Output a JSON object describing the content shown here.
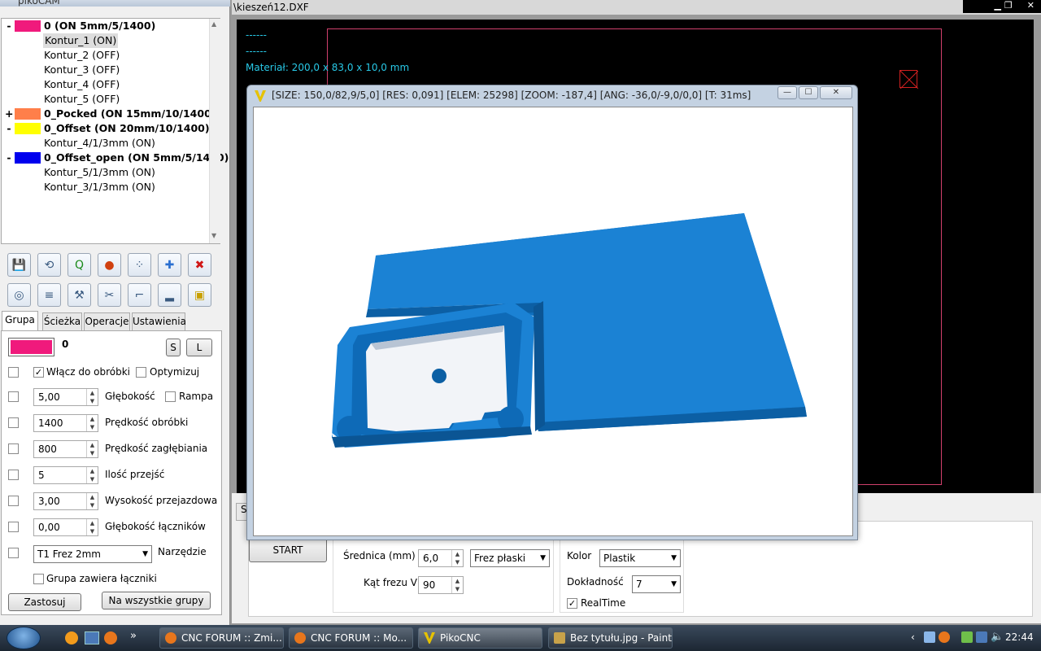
{
  "left_window": {
    "title": "pikoCAM",
    "tree": [
      {
        "expander": "-",
        "color": "#f01a7c",
        "label": "0 (ON 5mm/5/1400)",
        "type": "group"
      },
      {
        "expander": "",
        "color": "",
        "label": "Kontur_1 (ON)",
        "type": "item",
        "selected": true
      },
      {
        "expander": "",
        "color": "",
        "label": "Kontur_2 (OFF)",
        "type": "item"
      },
      {
        "expander": "",
        "color": "",
        "label": "Kontur_3 (OFF)",
        "type": "item"
      },
      {
        "expander": "",
        "color": "",
        "label": "Kontur_4 (OFF)",
        "type": "item"
      },
      {
        "expander": "",
        "color": "",
        "label": "Kontur_5 (OFF)",
        "type": "item"
      },
      {
        "expander": "+",
        "color": "#ff7f4a",
        "label": "0_Pocked (ON 15mm/10/1400)",
        "type": "group"
      },
      {
        "expander": "-",
        "color": "#ffff00",
        "label": "0_Offset (ON 20mm/10/1400)",
        "type": "group"
      },
      {
        "expander": "",
        "color": "",
        "label": "Kontur_4/1/3mm (ON)",
        "type": "item"
      },
      {
        "expander": "-",
        "color": "#0000ee",
        "label": "0_Offset_open (ON 5mm/5/1400)",
        "type": "group"
      },
      {
        "expander": "",
        "color": "",
        "label": "Kontur_5/1/3mm (ON)",
        "type": "item"
      },
      {
        "expander": "",
        "color": "",
        "label": "Kontur_3/1/3mm (ON)",
        "type": "item"
      }
    ],
    "toolbar_icons_row1": [
      "save-icon",
      "refresh-icon",
      "q-icon",
      "record-icon",
      "nodes-icon",
      "add-icon",
      "delete-icon"
    ],
    "toolbar_icons_row2": [
      "tool-paths-icon",
      "align-icon",
      "wand-icon",
      "cut-icon",
      "profile-icon",
      "pocket-icon",
      "box-icon"
    ],
    "tabs": [
      "Grupa",
      "Ścieżka",
      "Operacje",
      "Ustawienia"
    ],
    "group": {
      "color": "#f01a7c",
      "name": "0",
      "s_button": "S",
      "l_button": "L",
      "enable_label": "Włącz do obróbki",
      "optimize_label": "Optymizuj",
      "rows": [
        {
          "value": "5,00",
          "label": "Głębokość"
        },
        {
          "value": "1400",
          "label": "Prędkość obróbki"
        },
        {
          "value": "800",
          "label": "Prędkość zagłębiania"
        },
        {
          "value": "5",
          "label": "Ilość przejść"
        },
        {
          "value": "3,00",
          "label": "Wysokość przejazdowa"
        },
        {
          "value": "0,00",
          "label": "Głębokość łączników"
        }
      ],
      "ramp_label": "Rampa",
      "tool_select": "T1 Frez 2mm",
      "tool_label": "Narzędzie",
      "contains_links_label": "Grupa zawiera łączniki",
      "apply_button": "Zastosuj",
      "all_groups_button": "Na wszystkie grupy"
    }
  },
  "main_window": {
    "file_title": "\\kieszeń12.DXF",
    "canvas_text": [
      "------",
      "------",
      "Materiał: 200,0 x 83,0 x 10,0 mm"
    ],
    "lower": {
      "start_button": "START",
      "tab_stub": "S",
      "diameter_label": "Średnica (mm)",
      "diameter_value": "6,0",
      "cutter_type": "Frez płaski",
      "v_angle_label": "Kąt frezu V",
      "v_angle_value": "90",
      "color_label": "Kolor",
      "color_value": "Plastik",
      "accuracy_label": "Dokładność",
      "accuracy_value": "7",
      "realtime_label": "RealTime"
    }
  },
  "preview_window": {
    "title": "[SIZE: 150,0/82,9/5,0] [RES: 0,091] [ELEM: 25298] [ZOOM: -187,4] [ANG: -36,0/-9,0/0,0] [T: 31ms]",
    "minimize": "—",
    "maximize": "☐",
    "close": "✕"
  },
  "taskbar": {
    "items": [
      {
        "label": "CNC FORUM :: Zmi...",
        "icon": "firefox-icon"
      },
      {
        "label": "CNC FORUM :: Mo...",
        "icon": "firefox-icon"
      },
      {
        "label": "PikoCNC",
        "icon": "pikocnc-icon"
      },
      {
        "label": "Bez tytułu.jpg - Paint",
        "icon": "paint-icon"
      }
    ],
    "more": "»",
    "clock": "22:44"
  },
  "colors": {
    "model_blue": "#1a7fd0",
    "canvas_cyan": "#28c8e6",
    "canvas_border": "#d0406c"
  }
}
